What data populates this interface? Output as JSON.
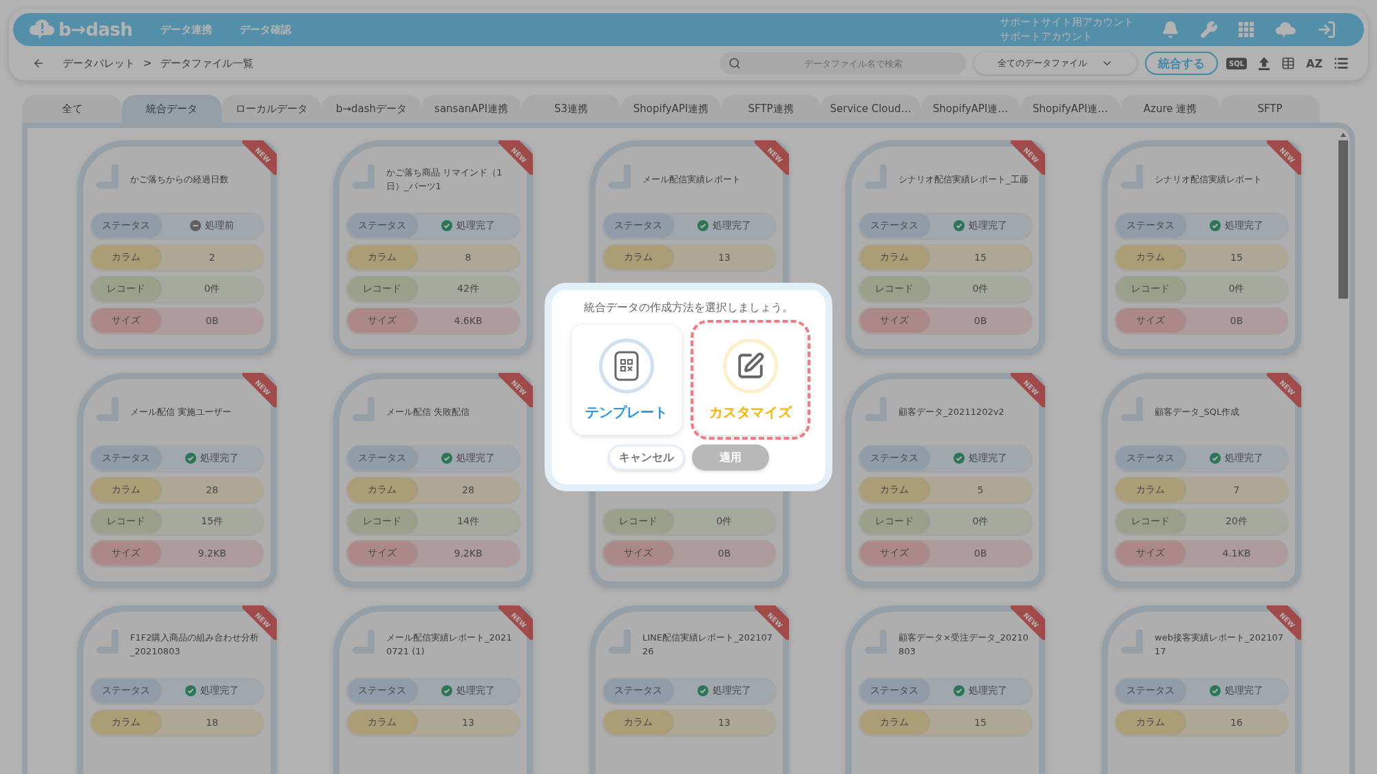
{
  "header": {
    "logo": "b→dash",
    "nav": [
      {
        "label": "データ連携"
      },
      {
        "label": "データ確認"
      }
    ],
    "account": [
      "サポートサイト用アカウント",
      "サポートアカウント"
    ]
  },
  "toolbar": {
    "breadcrumb": [
      "データパレット",
      ">",
      "データファイル一覧"
    ],
    "search": {
      "placeholder": "データファイル名で検索"
    },
    "filter": {
      "value": "全てのデータファイル"
    },
    "merge_button": "統合する",
    "sql_icon": "SQL",
    "sort_icon": "AZ"
  },
  "tabs": [
    {
      "label": "全て",
      "selected": false
    },
    {
      "label": "統合データ",
      "selected": true
    },
    {
      "label": "ローカルデータ",
      "selected": false
    },
    {
      "label": "b→dashデータ",
      "selected": false
    },
    {
      "label": "sansanAPI連携",
      "selected": false
    },
    {
      "label": "S3連携",
      "selected": false
    },
    {
      "label": "ShopifyAPI連携",
      "selected": false
    },
    {
      "label": "SFTP連携",
      "selected": false
    },
    {
      "label": "Service Cloud…",
      "selected": false
    },
    {
      "label": "ShopifyAPI連…",
      "selected": false
    },
    {
      "label": "ShopifyAPI連…",
      "selected": false
    },
    {
      "label": "Azure 連携",
      "selected": false
    },
    {
      "label": "SFTP",
      "selected": false
    }
  ],
  "cards": [
    {
      "title": "かご落ちからの経過日数",
      "badge": "NEW",
      "fields": [
        {
          "kind": "status",
          "label": "ステータス",
          "value": "処理前",
          "done": false
        },
        {
          "kind": "column",
          "label": "カラム",
          "value": "2"
        },
        {
          "kind": "record",
          "label": "レコード",
          "value": "0件"
        },
        {
          "kind": "size",
          "label": "サイズ",
          "value": "0B"
        }
      ]
    },
    {
      "title": "かご落ち商品 リマインド（1日）_パーツ1",
      "badge": "NEW",
      "fields": [
        {
          "kind": "status",
          "label": "ステータス",
          "value": "処理完了",
          "done": true
        },
        {
          "kind": "column",
          "label": "カラム",
          "value": "8"
        },
        {
          "kind": "record",
          "label": "レコード",
          "value": "42件"
        },
        {
          "kind": "size",
          "label": "サイズ",
          "value": "4.6KB"
        }
      ]
    },
    {
      "title": "メール配信実績レポート",
      "badge": "NEW",
      "fields": [
        {
          "kind": "status",
          "label": "ステータス",
          "value": "処理完了",
          "done": true
        },
        {
          "kind": "column",
          "label": "カラム",
          "value": "13"
        }
      ]
    },
    {
      "title": "シナリオ配信実績レポート_工藤",
      "badge": "NEW",
      "fields": [
        {
          "kind": "status",
          "label": "ステータス",
          "value": "処理完了",
          "done": true
        },
        {
          "kind": "column",
          "label": "カラム",
          "value": "15"
        },
        {
          "kind": "record",
          "label": "レコード",
          "value": "0件"
        },
        {
          "kind": "size",
          "label": "サイズ",
          "value": "0B"
        }
      ]
    },
    {
      "title": "シナリオ配信実績レポート",
      "badge": "NEW",
      "fields": [
        {
          "kind": "status",
          "label": "ステータス",
          "value": "処理完了",
          "done": true
        },
        {
          "kind": "column",
          "label": "カラム",
          "value": "15"
        },
        {
          "kind": "record",
          "label": "レコード",
          "value": "0件"
        },
        {
          "kind": "size",
          "label": "サイズ",
          "value": "0B"
        }
      ]
    },
    {
      "title": "メール配信 実施ユーザー",
      "badge": "NEW",
      "fields": [
        {
          "kind": "status",
          "label": "ステータス",
          "value": "処理完了",
          "done": true
        },
        {
          "kind": "column",
          "label": "カラム",
          "value": "28"
        },
        {
          "kind": "record",
          "label": "レコード",
          "value": "15件"
        },
        {
          "kind": "size",
          "label": "サイズ",
          "value": "9.2KB"
        }
      ]
    },
    {
      "title": "メール配信 失敗配信",
      "badge": "NEW",
      "fields": [
        {
          "kind": "status",
          "label": "ステータス",
          "value": "処理完了",
          "done": true
        },
        {
          "kind": "column",
          "label": "カラム",
          "value": "28"
        },
        {
          "kind": "record",
          "label": "レコード",
          "value": "14件"
        },
        {
          "kind": "size",
          "label": "サイズ",
          "value": "9.2KB"
        }
      ]
    },
    {
      "fields": [
        {
          "kind": "record",
          "label": "レコード",
          "value": "0件"
        },
        {
          "kind": "size",
          "label": "サイズ",
          "value": "0B"
        }
      ]
    },
    {
      "title": "顧客データ_20211202v2",
      "badge": "NEW",
      "fields": [
        {
          "kind": "status",
          "label": "ステータス",
          "value": "処理完了",
          "done": true
        },
        {
          "kind": "column",
          "label": "カラム",
          "value": "5"
        },
        {
          "kind": "record",
          "label": "レコード",
          "value": "0件"
        },
        {
          "kind": "size",
          "label": "サイズ",
          "value": "0B"
        }
      ]
    },
    {
      "title": "顧客データ_SQL作成",
      "badge": "NEW",
      "fields": [
        {
          "kind": "status",
          "label": "ステータス",
          "value": "処理完了",
          "done": true
        },
        {
          "kind": "column",
          "label": "カラム",
          "value": "7"
        },
        {
          "kind": "record",
          "label": "レコード",
          "value": "20件"
        },
        {
          "kind": "size",
          "label": "サイズ",
          "value": "4.1KB"
        }
      ]
    },
    {
      "title": "F1F2購入商品の組み合わせ分析_20210803",
      "badge": "NEW",
      "fields": [
        {
          "kind": "status",
          "label": "ステータス",
          "value": "処理完了",
          "done": true
        },
        {
          "kind": "column",
          "label": "カラム",
          "value": "18"
        }
      ]
    },
    {
      "title": "メール配信実績レポート_20210721 (1)",
      "badge": "NEW",
      "fields": [
        {
          "kind": "status",
          "label": "ステータス",
          "value": "処理完了",
          "done": true
        },
        {
          "kind": "column",
          "label": "カラム",
          "value": "13"
        }
      ]
    },
    {
      "title": "LINE配信実績レポート_20210726",
      "badge": "NEW",
      "fields": [
        {
          "kind": "status",
          "label": "ステータス",
          "value": "処理完了",
          "done": true
        },
        {
          "kind": "column",
          "label": "カラム",
          "value": "13"
        }
      ]
    },
    {
      "title": "顧客データ×受注データ_20210803",
      "badge": "NEW",
      "fields": [
        {
          "kind": "status",
          "label": "ステータス",
          "value": "処理完了",
          "done": true
        },
        {
          "kind": "column",
          "label": "カラム",
          "value": "15"
        }
      ]
    },
    {
      "title": "web接客実績レポート_20210717",
      "badge": "NEW",
      "fields": [
        {
          "kind": "status",
          "label": "ステータス",
          "value": "処理完了",
          "done": true
        },
        {
          "kind": "column",
          "label": "カラム",
          "value": "16"
        }
      ]
    }
  ],
  "dialog": {
    "prompt": "統合データの作成方法を選択しましょう。",
    "options": [
      {
        "kind": "template",
        "label": "テンプレート",
        "selected": false
      },
      {
        "kind": "customize",
        "label": "カスタマイズ",
        "selected": true
      }
    ],
    "buttons": [
      {
        "label": "キャンセル",
        "disabled": false
      },
      {
        "label": "適用",
        "disabled": true
      }
    ]
  }
}
